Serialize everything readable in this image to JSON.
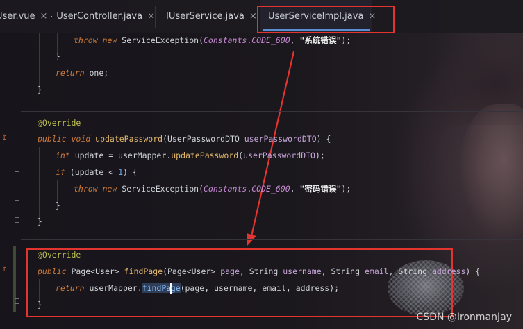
{
  "tabs": [
    {
      "label": "User.vue",
      "icon": "vue-icon"
    },
    {
      "label": "UserController.java",
      "icon": "java-class-icon"
    },
    {
      "label": "IUserService.java",
      "icon": "java-interface-icon"
    },
    {
      "label": "UserServiceImpl.java",
      "icon": "java-class-icon",
      "active": true
    }
  ],
  "close_glyph": "×",
  "code": {
    "l1": {
      "kw1": "throw",
      "kw2": "new",
      "cls": "ServiceException",
      "const_cls": "Constants",
      "const": "CODE_600",
      "str": "\"系统错误\""
    },
    "l2": "}",
    "l3": {
      "kw": "return",
      "rest": " one;"
    },
    "l4": "}",
    "l5": "@Override",
    "l6": {
      "kw1": "public",
      "kw2": "void",
      "fn": "updatePassword",
      "type": "UserPasswordDTO",
      "param": "userPasswordDTO"
    },
    "l7": {
      "kw": "int",
      "var": "update",
      "obj": "userMapper",
      "fn": "updatePassword",
      "arg": "userPasswordDTO"
    },
    "l8": {
      "kw": "if",
      "var": "update",
      "op": "<",
      "num": "1"
    },
    "l9": {
      "kw1": "throw",
      "kw2": "new",
      "cls": "ServiceException",
      "const_cls": "Constants",
      "const": "CODE_600",
      "str": "\"密码错误\""
    },
    "l10": "}",
    "l11": "}",
    "l12": "@Override",
    "l13": {
      "kw": "public",
      "ret": "Page<User>",
      "fn": "findPage",
      "t1": "Page<User>",
      "p1": "page",
      "t2": "String",
      "p2": "username",
      "t3": "String",
      "p3": "email",
      "t4": "String",
      "p4": "address"
    },
    "l14": {
      "kw": "return",
      "obj": "userMapper",
      "fn_a": "findPa",
      "fn_b": "ge",
      "args": "(page, username, email, address);"
    },
    "l15": "}"
  },
  "watermark": "CSDN @IronmanJay",
  "colors": {
    "accent": "#5a8fd8",
    "annotation_red": "#e3342f"
  }
}
